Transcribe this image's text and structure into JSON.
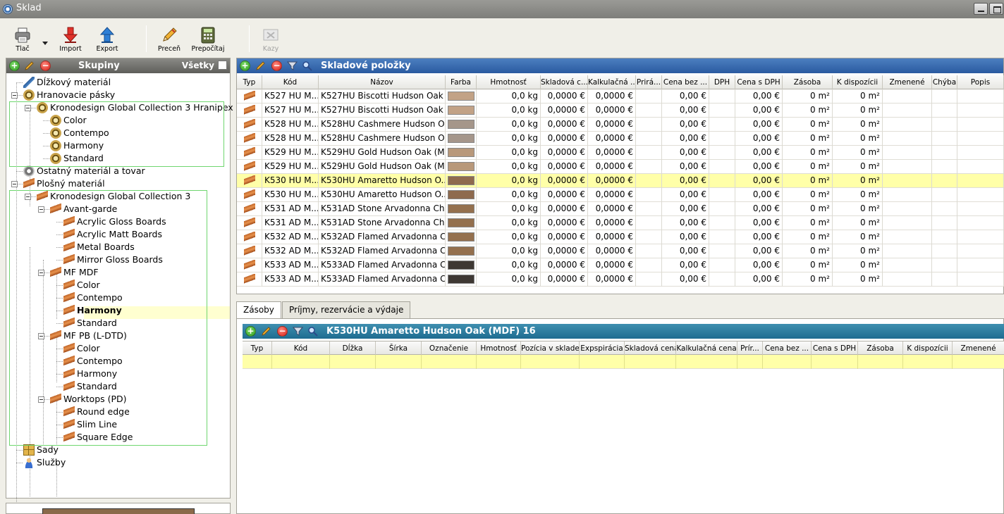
{
  "window": {
    "title": "Sklad"
  },
  "toolbar": {
    "print": "Tlač",
    "import": "Import",
    "export": "Export",
    "recalc_price": "Preceň",
    "recalc": "Prepočítaj",
    "defects": "Kazy"
  },
  "groups_panel": {
    "title": "Skupiny",
    "all_label": "Všetky",
    "tree": [
      {
        "label": "Dĺžkový materiál",
        "icon": "ruler-icon"
      },
      {
        "label": "Hranovacie pásky",
        "icon": "edge-tape-icon"
      },
      {
        "label": "Kronodesign Global Collection 3 Hranipex",
        "icon": "edge-tape-icon"
      },
      {
        "label": "Color",
        "icon": "edge-tape-icon"
      },
      {
        "label": "Contempo",
        "icon": "edge-tape-icon"
      },
      {
        "label": "Harmony",
        "icon": "edge-tape-icon"
      },
      {
        "label": "Standard",
        "icon": "edge-tape-icon"
      },
      {
        "label": "Ostatný materiál a tovar",
        "icon": "gear-icon"
      },
      {
        "label": "Plošný materiál",
        "icon": "board-icon"
      },
      {
        "label": "Kronodesign Global Collection 3",
        "icon": "board-icon"
      },
      {
        "label": "Avant-garde",
        "icon": "board-icon"
      },
      {
        "label": "Acrylic Gloss Boards",
        "icon": "board-icon"
      },
      {
        "label": "Acrylic Matt Boards",
        "icon": "board-icon"
      },
      {
        "label": "Metal Boards",
        "icon": "board-icon"
      },
      {
        "label": "Mirror Gloss Boards",
        "icon": "board-icon"
      },
      {
        "label": "MF MDF",
        "icon": "board-icon"
      },
      {
        "label": "Color",
        "icon": "board-icon"
      },
      {
        "label": "Contempo",
        "icon": "board-icon"
      },
      {
        "label": "Harmony",
        "icon": "board-icon",
        "selected": true
      },
      {
        "label": "Standard",
        "icon": "board-icon"
      },
      {
        "label": "MF PB (L-DTD)",
        "icon": "board-icon"
      },
      {
        "label": "Color",
        "icon": "board-icon"
      },
      {
        "label": "Contempo",
        "icon": "board-icon"
      },
      {
        "label": "Harmony",
        "icon": "board-icon"
      },
      {
        "label": "Standard",
        "icon": "board-icon"
      },
      {
        "label": "Worktops (PD)",
        "icon": "board-icon"
      },
      {
        "label": "Round edge",
        "icon": "board-icon"
      },
      {
        "label": "Slim Line",
        "icon": "board-icon"
      },
      {
        "label": "Square Edge",
        "icon": "board-icon"
      },
      {
        "label": "Sady",
        "icon": "set-icon"
      },
      {
        "label": "Služby",
        "icon": "person-icon"
      }
    ]
  },
  "items_panel": {
    "title": "Skladové položky",
    "columns": [
      "Typ",
      "Kód",
      "Názov",
      "Farba",
      "Hmotnosť",
      "Skladová c...",
      "Kalkulačná ...",
      "Prirá...",
      "Cena bez ...",
      "DPH",
      "Cena s DPH",
      "Zásoba",
      "K dispozícii",
      "Zmenené",
      "Chýba",
      "Popis"
    ],
    "rows": [
      {
        "code": "K527 HU M...",
        "name": "K527HU Biscotti Hudson Oak ...",
        "color": "#c2a286",
        "weight": "0,0 kg",
        "stock_price": "0,0000 €",
        "calc_price": "0,0000 €",
        "price_net": "0,00 €",
        "price_vat": "0,00 €",
        "stock": "0 m²",
        "available": "0 m²"
      },
      {
        "code": "K527 HU M...",
        "name": "K527HU Biscotti Hudson Oak ...",
        "color": "#c2a286",
        "weight": "0,0 kg",
        "stock_price": "0,0000 €",
        "calc_price": "0,0000 €",
        "price_net": "0,00 €",
        "price_vat": "0,00 €",
        "stock": "0 m²",
        "available": "0 m²"
      },
      {
        "code": "K528 HU M...",
        "name": "K528HU Cashmere Hudson O...",
        "color": "#a5968a",
        "weight": "0,0 kg",
        "stock_price": "0,0000 €",
        "calc_price": "0,0000 €",
        "price_net": "0,00 €",
        "price_vat": "0,00 €",
        "stock": "0 m²",
        "available": "0 m²"
      },
      {
        "code": "K528 HU M...",
        "name": "K528HU Cashmere Hudson O...",
        "color": "#a5968a",
        "weight": "0,0 kg",
        "stock_price": "0,0000 €",
        "calc_price": "0,0000 €",
        "price_net": "0,00 €",
        "price_vat": "0,00 €",
        "stock": "0 m²",
        "available": "0 m²"
      },
      {
        "code": "K529 HU M...",
        "name": "K529HU Gold Hudson Oak (M...",
        "color": "#b8987a",
        "weight": "0,0 kg",
        "stock_price": "0,0000 €",
        "calc_price": "0,0000 €",
        "price_net": "0,00 €",
        "price_vat": "0,00 €",
        "stock": "0 m²",
        "available": "0 m²"
      },
      {
        "code": "K529 HU M...",
        "name": "K529HU Gold Hudson Oak (M...",
        "color": "#b8987a",
        "weight": "0,0 kg",
        "stock_price": "0,0000 €",
        "calc_price": "0,0000 €",
        "price_net": "0,00 €",
        "price_vat": "0,00 €",
        "stock": "0 m²",
        "available": "0 m²"
      },
      {
        "code": "K530 HU M...",
        "name": "K530HU Amaretto Hudson O...",
        "color": "#8e6a4e",
        "weight": "0,0 kg",
        "stock_price": "0,0000 €",
        "calc_price": "0,0000 €",
        "price_net": "0,00 €",
        "price_vat": "0,00 €",
        "stock": "0 m²",
        "available": "0 m²",
        "selected": true
      },
      {
        "code": "K530 HU M...",
        "name": "K530HU Amaretto Hudson O...",
        "color": "#8e6a4e",
        "weight": "0,0 kg",
        "stock_price": "0,0000 €",
        "calc_price": "0,0000 €",
        "price_net": "0,00 €",
        "price_vat": "0,00 €",
        "stock": "0 m²",
        "available": "0 m²"
      },
      {
        "code": "K531 AD M...",
        "name": "K531AD Stone Arvadonna Ch...",
        "color": "#94704e",
        "weight": "0,0 kg",
        "stock_price": "0,0000 €",
        "calc_price": "0,0000 €",
        "price_net": "0,00 €",
        "price_vat": "0,00 €",
        "stock": "0 m²",
        "available": "0 m²"
      },
      {
        "code": "K531 AD M...",
        "name": "K531AD Stone Arvadonna Ch...",
        "color": "#94704e",
        "weight": "0,0 kg",
        "stock_price": "0,0000 €",
        "calc_price": "0,0000 €",
        "price_net": "0,00 €",
        "price_vat": "0,00 €",
        "stock": "0 m²",
        "available": "0 m²"
      },
      {
        "code": "K532 AD M...",
        "name": "K532AD Flamed Arvadonna C...",
        "color": "#94704e",
        "weight": "0,0 kg",
        "stock_price": "0,0000 €",
        "calc_price": "0,0000 €",
        "price_net": "0,00 €",
        "price_vat": "0,00 €",
        "stock": "0 m²",
        "available": "0 m²"
      },
      {
        "code": "K532 AD M...",
        "name": "K532AD Flamed Arvadonna C...",
        "color": "#94704e",
        "weight": "0,0 kg",
        "stock_price": "0,0000 €",
        "calc_price": "0,0000 €",
        "price_net": "0,00 €",
        "price_vat": "0,00 €",
        "stock": "0 m²",
        "available": "0 m²"
      },
      {
        "code": "K533 AD M...",
        "name": "K533AD Flamed Arvadonna C...",
        "color": "#3e3833",
        "weight": "0,0 kg",
        "stock_price": "0,0000 €",
        "calc_price": "0,0000 €",
        "price_net": "0,00 €",
        "price_vat": "0,00 €",
        "stock": "0 m²",
        "available": "0 m²"
      },
      {
        "code": "K533 AD M...",
        "name": "K533AD Flamed Arvadonna C...",
        "color": "#3e3833",
        "weight": "0,0 kg",
        "stock_price": "0,0000 €",
        "calc_price": "0,0000 €",
        "price_net": "0,00 €",
        "price_vat": "0,00 €",
        "stock": "0 m²",
        "available": "0 m²"
      }
    ]
  },
  "tabs": [
    "Zásoby",
    "Príjmy, rezervácie a výdaje"
  ],
  "stock_panel": {
    "title": "K530HU Amaretto Hudson Oak (MDF) 16",
    "columns": [
      "Typ",
      "Kód",
      "Dĺžka",
      "Šírka",
      "Označenie",
      "Hmotnosť",
      "Pozícia v sklade",
      "Expspirácia",
      "Skladová cena",
      "Kalkulačná cena",
      "Prír...",
      "Cena bez ...",
      "Cena s DPH",
      "Zásoba",
      "K dispozícii",
      "Zmenené"
    ]
  }
}
